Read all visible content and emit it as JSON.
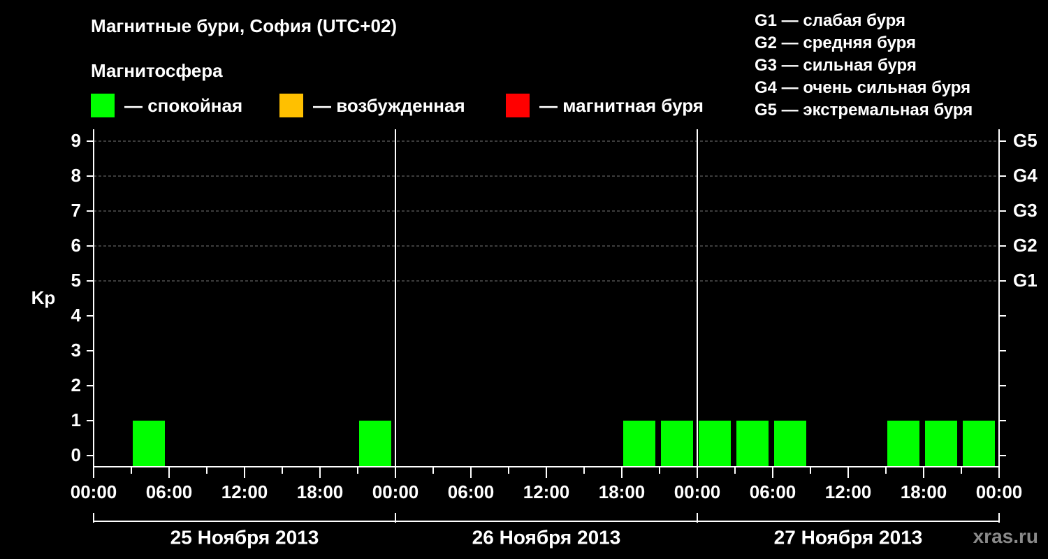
{
  "header": {
    "title": "Магнитные бури, София (UTC+02)",
    "subtitle": "Магнитосфера"
  },
  "legend": [
    {
      "label": "— спокойная",
      "color": "#00ff00"
    },
    {
      "label": "— возбужденная",
      "color": "#ffc000"
    },
    {
      "label": "— магнитная буря",
      "color": "#ff0000"
    }
  ],
  "g_legend": [
    "G1 — слабая буря",
    "G2 — средняя буря",
    "G3 — сильная буря",
    "G4 — очень сильная буря",
    "G5 — экстремальная буря"
  ],
  "watermark": "xras.ru",
  "chart_data": {
    "type": "bar",
    "ylabel": "Kp",
    "ylim": [
      0,
      9
    ],
    "y_ticks": [
      0,
      1,
      2,
      3,
      4,
      5,
      6,
      7,
      8,
      9
    ],
    "right_axis_labels": [
      {
        "kp": 5,
        "label": "G1"
      },
      {
        "kp": 6,
        "label": "G2"
      },
      {
        "kp": 7,
        "label": "G3"
      },
      {
        "kp": 8,
        "label": "G4"
      },
      {
        "kp": 9,
        "label": "G5"
      }
    ],
    "grid": "dashed horizontal lines at Kp 5–9",
    "x_range_hours": [
      0,
      72
    ],
    "x_tick_labels": [
      "00:00",
      "06:00",
      "12:00",
      "18:00",
      "00:00",
      "06:00",
      "12:00",
      "18:00",
      "00:00",
      "06:00",
      "12:00",
      "18:00",
      "00:00"
    ],
    "days": [
      "25 Ноября 2013",
      "26 Ноября 2013",
      "27 Ноября 2013"
    ],
    "bar_interval_hours": 3,
    "values": [
      0,
      1,
      0,
      0,
      0,
      0,
      0,
      1,
      0,
      0,
      0,
      0,
      0,
      0,
      1,
      1,
      1,
      1,
      1,
      0,
      0,
      1,
      1,
      1
    ],
    "colors": {
      "quiet": "#00ff00",
      "active": "#ffc000",
      "storm": "#ff0000"
    }
  }
}
